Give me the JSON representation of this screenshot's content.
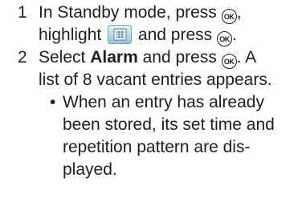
{
  "steps": [
    {
      "number": "1",
      "line1_a": "In Standby mode, press",
      "line1_b": ",",
      "line2_a": "highlight",
      "line2_b": "and press",
      "line2_c": ".",
      "icon": "menu-settings-icon"
    },
    {
      "number": "2",
      "line1_a": "Select",
      "line1_bold": "Alarm",
      "line1_b": "and press",
      "line1_c": ". A",
      "line2": "list of 8 vacant entries appears."
    }
  ],
  "bullet": {
    "symbol": "•",
    "lines": [
      "When an entry has already",
      "been stored, its set time and",
      "repetition pattern are dis-",
      "played."
    ]
  },
  "ok_key_label": "OK"
}
